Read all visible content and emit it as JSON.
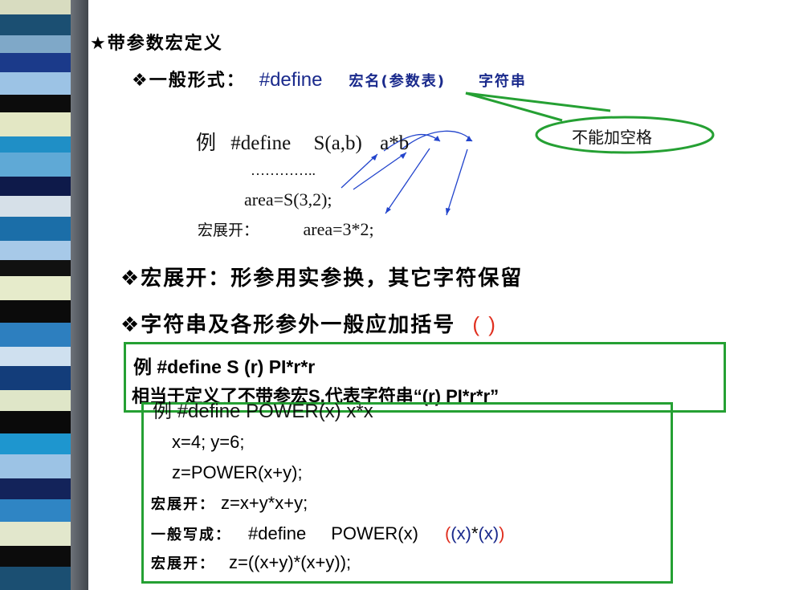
{
  "title": "★带参数宏定义",
  "general_form": {
    "label": "❖一般形式：",
    "keyword": "#define",
    "macro_params": "宏名(参数表)",
    "string_word": "字符串"
  },
  "callout": "不能加空格",
  "example1": {
    "head_li": "例",
    "head_define": "#define",
    "head_macro": "S(a,b)",
    "head_body": "a*b",
    "dots": "…………..",
    "line2": "area=S(3,2);",
    "expand_label": "宏展开：",
    "expand_value": "area=3*2;"
  },
  "points": [
    "❖宏展开：形参用实参换，其它字符保留",
    "❖字符串及各形参外一般应加括号"
  ],
  "paren_glyph": "( )",
  "box1": {
    "line1": "例 #define  S  (r)   PI*r*r",
    "line2": "相当于定义了不带参宏S,代表字符串“(r)   PI*r*r”"
  },
  "box2": {
    "line0": "例  #define   POWER(x)        x*x",
    "line1": "x=4;  y=6;",
    "line2": "z=POWER(x+y);",
    "expand1_label": "宏展开：",
    "expand1_value": "z=x+y*x+y;",
    "general_label": "一般写成：",
    "general_define": "#define",
    "general_macro": "POWER(x)",
    "general_p1": "(",
    "general_p2": "(x)",
    "general_p3": "*",
    "general_p4": "(x)",
    "general_p5": ")",
    "expand2_label": "宏展开：",
    "expand2_value": "z=((x+y)*(x+y));"
  },
  "colors": {
    "blue_text": "#1a2a8c",
    "bullet": "#e8a020",
    "green_box": "#25a033",
    "red_paren": "#e03020"
  }
}
